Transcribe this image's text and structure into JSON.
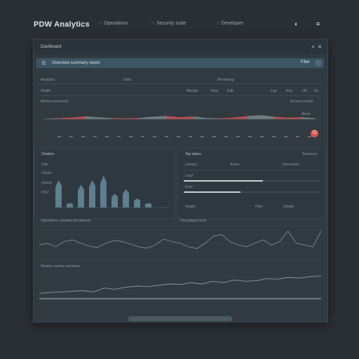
{
  "app": {
    "title": "PDW Analytics"
  },
  "nav": [
    {
      "label": "Operations",
      "icon": "circle-icon"
    },
    {
      "label": "Security suite",
      "icon": "circle-icon"
    },
    {
      "label": "Developer",
      "icon": "circle-icon"
    }
  ],
  "top_icons": {
    "moon": "◐",
    "menu": "≡"
  },
  "window": {
    "title": "Dashboard",
    "controls": {
      "search": "⌕",
      "close": "✕"
    }
  },
  "toolbar": {
    "label": "Overview summary report",
    "right_label": "Filter",
    "info_icon": "ⓘ"
  },
  "summary": {
    "left": "Analytics",
    "mid1": "Stats",
    "mid2": "Monitoring",
    "row2": [
      "Health",
      "Monitor",
      "View",
      "Edit",
      "Log",
      "Run",
      "Off",
      "Fix"
    ],
    "row3_left": "Metrics and trend",
    "row3_right": "Access control",
    "row4_right": "Alerts"
  },
  "wave_chart": {
    "baseline_values": [
      0.2,
      0.5,
      0.8,
      1.4,
      0.9,
      0.5,
      0.4,
      0.6,
      1.2,
      1.6,
      0.9,
      1.3,
      0.6,
      0.4,
      0.8,
      1.5,
      1.9,
      1.2,
      0.7,
      0.9,
      0.5
    ]
  },
  "bar_panel": {
    "title": "Clusters",
    "ylabels": [
      "Disk",
      "Cache",
      "Queue",
      "CPU"
    ],
    "values": [
      6,
      1,
      5,
      6,
      7,
      3,
      4,
      2,
      1
    ],
    "colors": {
      "bar": "#5d7f8f"
    }
  },
  "list_panel": {
    "title": "Top status",
    "right_title": "Resource",
    "rows": [
      {
        "name": "Latency",
        "mid": "Active",
        "right": "Connected"
      },
      {
        "name": "Load",
        "mid": "",
        "right": ""
      },
      {
        "name": "Error",
        "mid": "",
        "right": ""
      },
      {
        "name": "Reads",
        "mid": "Filter",
        "right": "Details"
      }
    ],
    "progress": [
      0.58,
      0.42
    ]
  },
  "line_panel_1": {
    "title": "Operations overview breakdown",
    "legend": "Throughput trend",
    "values": [
      0.45,
      0.5,
      0.4,
      0.55,
      0.6,
      0.5,
      0.42,
      0.38,
      0.5,
      0.58,
      0.55,
      0.48,
      0.4,
      0.36,
      0.45,
      0.62,
      0.55,
      0.5,
      0.4,
      0.35,
      0.5,
      0.7,
      0.75,
      0.55,
      0.45,
      0.4,
      0.5,
      0.6,
      0.45,
      0.55,
      0.85,
      0.5,
      0.45,
      0.4,
      0.85
    ]
  },
  "line_panel_2": {
    "title": "Weekly metrics summary",
    "values": [
      0.15,
      0.18,
      0.2,
      0.22,
      0.25,
      0.2,
      0.35,
      0.3,
      0.38,
      0.42,
      0.4,
      0.45,
      0.5,
      0.48,
      0.55,
      0.5,
      0.6,
      0.55,
      0.65,
      0.6,
      0.62,
      0.7,
      0.68,
      0.75,
      0.72,
      0.78,
      0.8
    ]
  },
  "colors": {
    "accent": "#3b5564",
    "alert": "#d9534f",
    "wave": "#7e8c92"
  }
}
